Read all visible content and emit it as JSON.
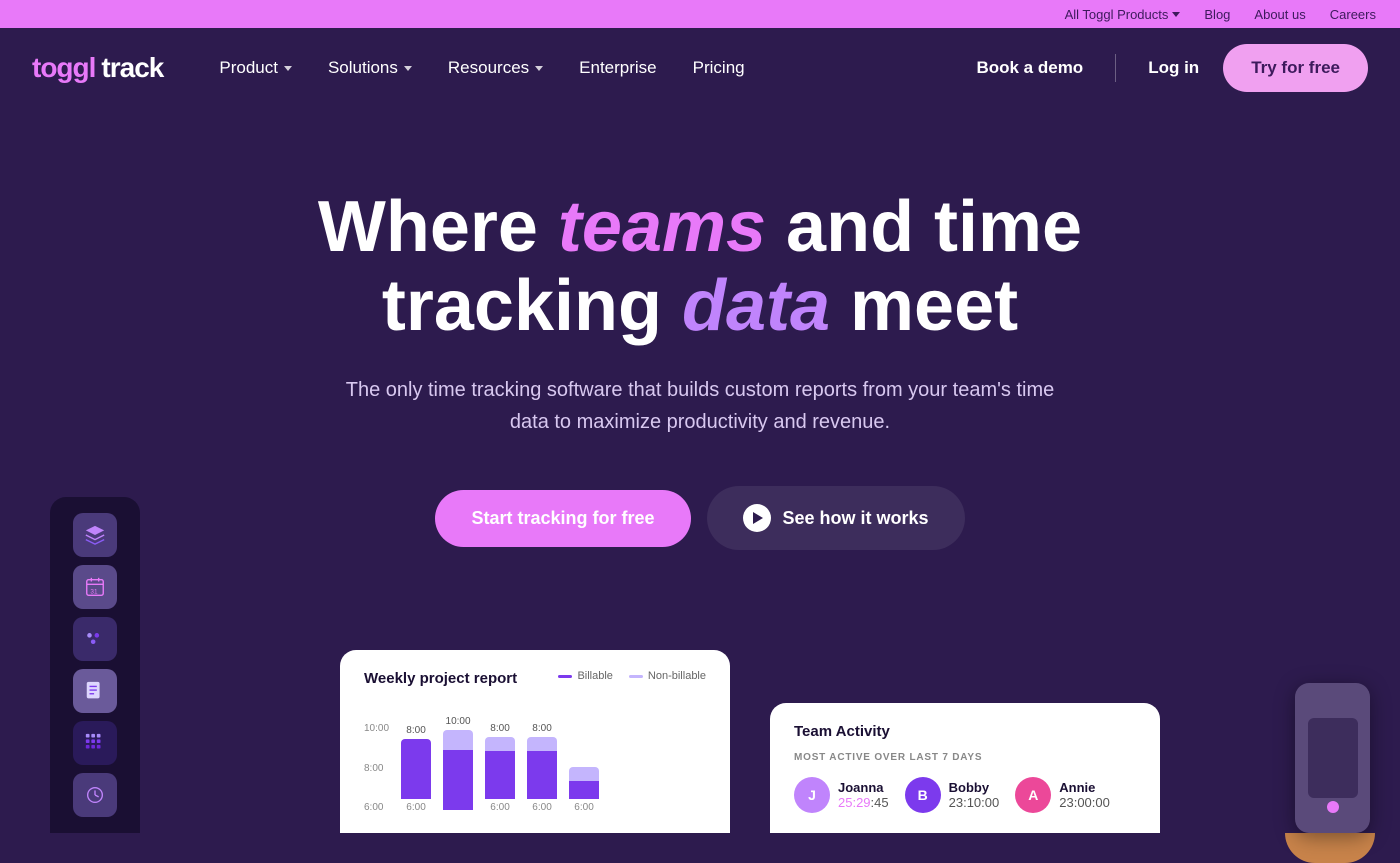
{
  "topBanner": {
    "products_label": "All Toggl Products",
    "blog_label": "Blog",
    "about_label": "About us",
    "careers_label": "Careers"
  },
  "navbar": {
    "logo_toggl": "toggl",
    "logo_track": "track",
    "product_label": "Product",
    "solutions_label": "Solutions",
    "resources_label": "Resources",
    "enterprise_label": "Enterprise",
    "pricing_label": "Pricing",
    "book_demo_label": "Book a demo",
    "login_label": "Log in",
    "try_label": "Try for free"
  },
  "hero": {
    "title_part1": "Where ",
    "title_teams": "teams",
    "title_part2": " and time tracking ",
    "title_data": "data",
    "title_part3": " meet",
    "subtitle": "The only time tracking software that builds custom reports from your team's time data to maximize productivity and revenue.",
    "cta_primary": "Start tracking for free",
    "cta_secondary": "See how it works"
  },
  "weeklyReport": {
    "title": "Weekly project report",
    "legend_billable": "Billable",
    "legend_nonbillable": "Non-billable",
    "bars": [
      {
        "label_top": "8:00",
        "billable_h": 55,
        "nonbillable_h": 0,
        "label_bottom": "6:00"
      },
      {
        "label_top": "10:00",
        "billable_h": 80,
        "nonbillable_h": 20,
        "label_bottom": ""
      },
      {
        "label_top": "8:00",
        "billable_h": 55,
        "nonbillable_h": 20,
        "label_bottom": "6:00"
      },
      {
        "label_top": "8:00",
        "billable_h": 55,
        "nonbillable_h": 20,
        "label_bottom": "6:00"
      },
      {
        "label_top": "",
        "billable_h": 20,
        "nonbillable_h": 20,
        "label_bottom": "6:00"
      }
    ]
  },
  "teamActivity": {
    "title": "Team Activity",
    "most_active_label": "MOST ACTIVE OVER LAST 7 DAYS",
    "members": [
      {
        "name": "Joanna",
        "time": "25:29",
        "seconds": ":45",
        "initials": "J"
      },
      {
        "name": "Bobby",
        "time": "23:10",
        "seconds": ":00",
        "initials": "B"
      },
      {
        "name": "Annie",
        "time": "23:00",
        "seconds": ":00",
        "initials": "A"
      }
    ]
  },
  "colors": {
    "accent_pink": "#e879f9",
    "accent_purple": "#7c3aed",
    "bg_dark": "#2d1b4e",
    "bg_banner": "#e879f9"
  }
}
